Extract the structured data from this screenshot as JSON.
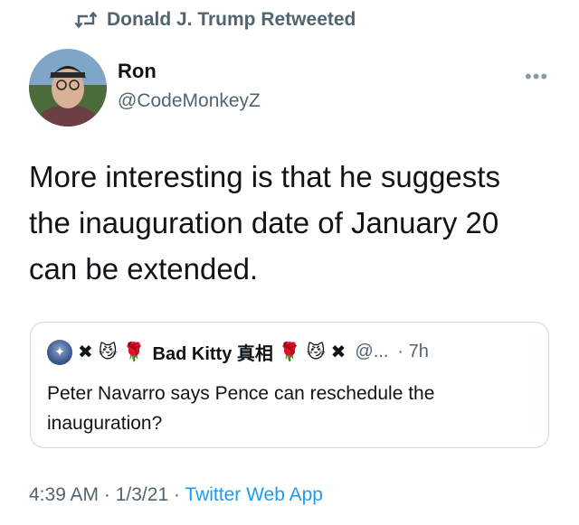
{
  "retweet": {
    "icon": "retweet-icon",
    "label": "Donald J. Trump Retweeted"
  },
  "author": {
    "name": "Ron",
    "handle": "@CodeMonkeyZ"
  },
  "tweet": {
    "text": "More interesting is that he suggests\nthe inauguration date of January 20\ncan be extended."
  },
  "quote": {
    "icons": [
      "✖",
      "😼",
      "🌹"
    ],
    "name": "Bad Kitty 真相",
    "icons_after": [
      "🌹",
      "😼",
      "✖"
    ],
    "handle": "@...",
    "time": "· 7h",
    "text": "Peter Navarro says Pence can reschedule the inauguration?"
  },
  "footer": {
    "time": "4:39 AM",
    "sep1": " · ",
    "date": "1/3/21",
    "sep2": " · ",
    "source": "Twitter Web App"
  },
  "more_icon": "more-icon",
  "colors": {
    "secondary_text": "#536471",
    "link": "#1d9bf0",
    "border": "#cfd9de"
  }
}
